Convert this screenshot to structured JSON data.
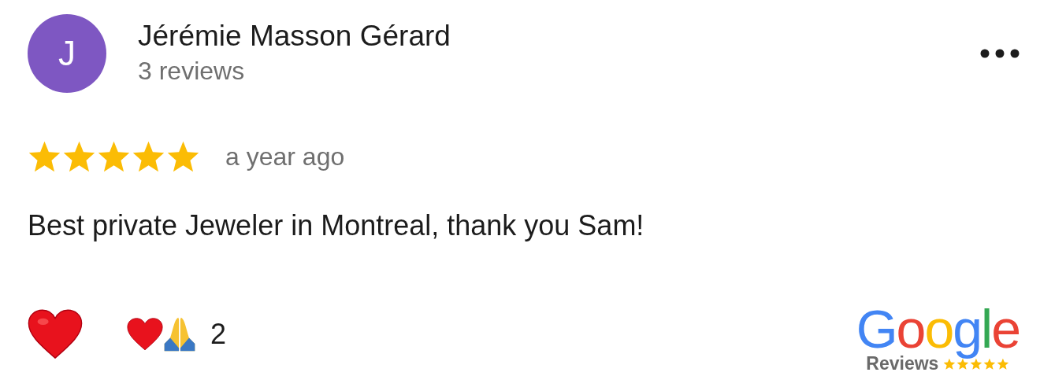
{
  "reviewer": {
    "initial": "J",
    "name": "Jérémie Masson Gérard",
    "review_count": "3 reviews"
  },
  "review": {
    "stars": 5,
    "time": "a year ago",
    "text": "Best private Jeweler in Montreal, thank you Sam!"
  },
  "reactions": {
    "count": "2"
  },
  "badge": {
    "logo": "Google",
    "caption": "Reviews"
  }
}
